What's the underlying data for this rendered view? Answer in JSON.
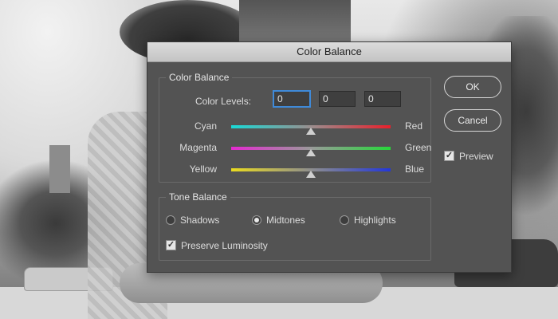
{
  "dialog": {
    "title": "Color Balance",
    "color_balance_group": {
      "title": "Color Balance",
      "levels_label": "Color Levels:",
      "levels": [
        "0",
        "0",
        "0"
      ],
      "sliders": [
        {
          "left": "Cyan",
          "right": "Red",
          "value": 0
        },
        {
          "left": "Magenta",
          "right": "Green",
          "value": 0
        },
        {
          "left": "Yellow",
          "right": "Blue",
          "value": 0
        }
      ]
    },
    "tone_balance_group": {
      "title": "Tone Balance",
      "options": [
        "Shadows",
        "Midtones",
        "Highlights"
      ],
      "selected": "Midtones",
      "preserve_luminosity_label": "Preserve Luminosity",
      "preserve_luminosity_checked": true
    },
    "buttons": {
      "ok": "OK",
      "cancel": "Cancel"
    },
    "preview": {
      "label": "Preview",
      "checked": true
    }
  }
}
